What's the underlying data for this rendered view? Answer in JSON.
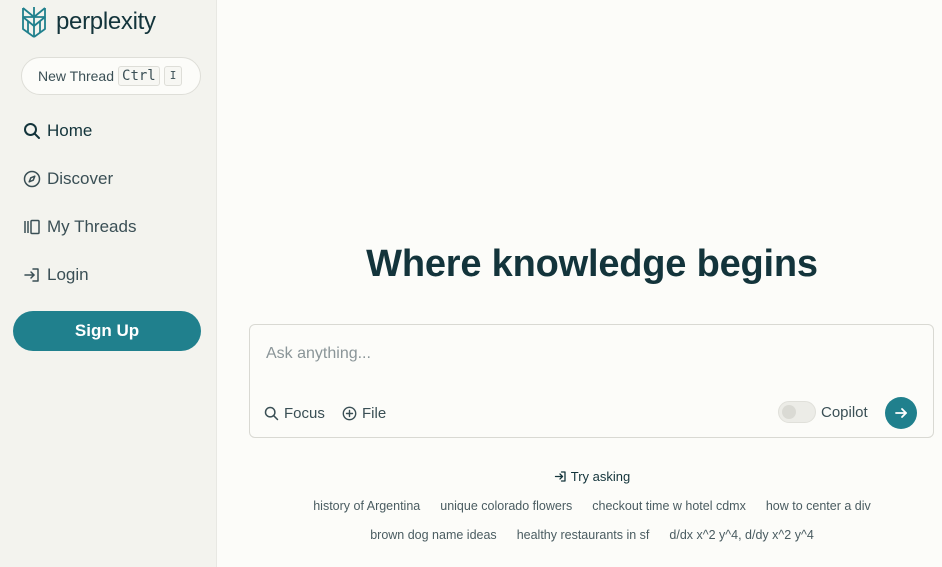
{
  "brand": {
    "name": "perplexity",
    "color": "#20808d"
  },
  "sidebar": {
    "new_thread": {
      "label": "New Thread",
      "kbd_1": "Ctrl",
      "kbd_2": "I"
    },
    "nav": [
      {
        "label": "Home",
        "icon": "search-icon"
      },
      {
        "label": "Discover",
        "icon": "compass-icon"
      },
      {
        "label": "My Threads",
        "icon": "library-icon"
      },
      {
        "label": "Login",
        "icon": "login-icon"
      }
    ],
    "signup_label": "Sign Up"
  },
  "main": {
    "headline": "Where knowledge begins",
    "ask": {
      "placeholder": "Ask anything...",
      "focus_label": "Focus",
      "file_label": "File",
      "copilot_label": "Copilot",
      "copilot_enabled": false
    },
    "try_asking_label": "Try asking",
    "suggestions_row1": [
      "history of Argentina",
      "unique colorado flowers",
      "checkout time w hotel cdmx",
      "how to center a div"
    ],
    "suggestions_row2": [
      "brown dog name ideas",
      "healthy restaurants in sf",
      "d/dx x^2 y^4, d/dy x^2 y^4"
    ]
  }
}
